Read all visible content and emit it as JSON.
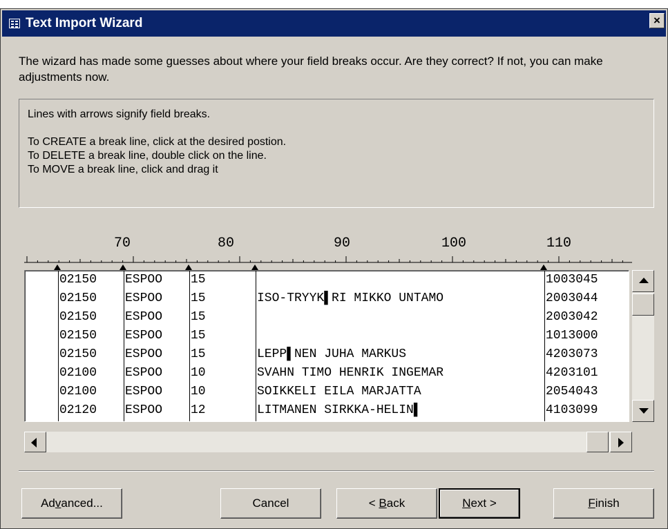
{
  "window": {
    "title": "Text Import Wizard",
    "close_glyph": "×"
  },
  "intro": "The wizard has made some guesses about where your field breaks occur.  Are they correct? If not, you can make adjustments now.",
  "instructions": {
    "line1": "Lines with arrows signify field breaks.",
    "line2": "To CREATE a break line, click at the desired postion.",
    "line3": "To DELETE a break line, double click on the line.",
    "line4": "To MOVE a break line, click and drag it"
  },
  "ruler": {
    "labels": [
      "70",
      "80",
      "90",
      "100",
      "110"
    ]
  },
  "preview": {
    "rows": [
      {
        "zip": "02150",
        "city": "ESPOO",
        "code": "15",
        "name": "",
        "num": "1003045"
      },
      {
        "zip": "02150",
        "city": "ESPOO",
        "code": "15",
        "name": "ISO-TRYYK▌RI MIKKO UNTAMO",
        "num": "2003044"
      },
      {
        "zip": "02150",
        "city": "ESPOO",
        "code": "15",
        "name": "",
        "num": "2003042"
      },
      {
        "zip": "02150",
        "city": "ESPOO",
        "code": "15",
        "name": "",
        "num": "1013000"
      },
      {
        "zip": "02150",
        "city": "ESPOO",
        "code": "15",
        "name": "LEPP▌NEN JUHA MARKUS",
        "num": "4203073"
      },
      {
        "zip": "02100",
        "city": "ESPOO",
        "code": "10",
        "name": "SVAHN TIMO HENRIK INGEMAR",
        "num": "4203101"
      },
      {
        "zip": "02100",
        "city": "ESPOO",
        "code": "10",
        "name": "SOIKKELI EILA MARJATTA",
        "num": "2054043"
      },
      {
        "zip": "02120",
        "city": "ESPOO",
        "code": "12",
        "name": "LITMANEN SIRKKA-HELIN▌",
        "num": "4103099"
      }
    ]
  },
  "buttons": {
    "advanced": {
      "pre": "Ad",
      "key": "v",
      "post": "anced..."
    },
    "cancel": "Cancel",
    "back": {
      "pre": "< ",
      "key": "B",
      "post": "ack"
    },
    "next": {
      "key": "N",
      "post": "ext >"
    },
    "finish": {
      "key": "F",
      "post": "inish"
    }
  },
  "colors": {
    "titlebar": "#0a246a",
    "dialog_bg": "#d4d0c8",
    "preview_bg": "#ffffff"
  }
}
